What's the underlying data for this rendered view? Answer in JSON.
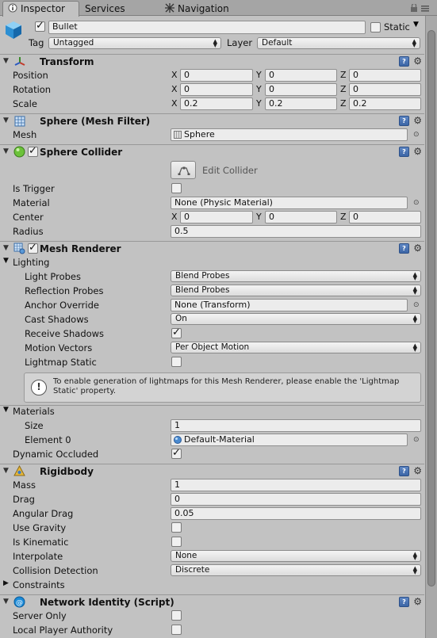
{
  "tabs": {
    "inspector": "Inspector",
    "services": "Services",
    "navigation": "Navigation"
  },
  "object": {
    "name": "Bullet",
    "static_label": "Static",
    "tag_label": "Tag",
    "tag_value": "Untagged",
    "layer_label": "Layer",
    "layer_value": "Default"
  },
  "transform": {
    "title": "Transform",
    "position_label": "Position",
    "rotation_label": "Rotation",
    "scale_label": "Scale",
    "x": "X",
    "y": "Y",
    "z": "Z",
    "position": [
      "0",
      "0",
      "0"
    ],
    "rotation": [
      "0",
      "0",
      "0"
    ],
    "scale": [
      "0.2",
      "0.2",
      "0.2"
    ]
  },
  "mesh_filter": {
    "title": "Sphere (Mesh Filter)",
    "mesh_label": "Mesh",
    "mesh_value": "Sphere"
  },
  "sphere_collider": {
    "title": "Sphere Collider",
    "edit_collider": "Edit Collider",
    "is_trigger_label": "Is Trigger",
    "material_label": "Material",
    "material_value": "None (Physic Material)",
    "center_label": "Center",
    "center": [
      "0",
      "0",
      "0"
    ],
    "radius_label": "Radius",
    "radius_value": "0.5"
  },
  "mesh_renderer": {
    "title": "Mesh Renderer",
    "lighting_label": "Lighting",
    "light_probes_label": "Light Probes",
    "light_probes_value": "Blend Probes",
    "reflection_probes_label": "Reflection Probes",
    "reflection_probes_value": "Blend Probes",
    "anchor_override_label": "Anchor Override",
    "anchor_override_value": "None (Transform)",
    "cast_shadows_label": "Cast Shadows",
    "cast_shadows_value": "On",
    "receive_shadows_label": "Receive Shadows",
    "motion_vectors_label": "Motion Vectors",
    "motion_vectors_value": "Per Object Motion",
    "lightmap_static_label": "Lightmap Static",
    "help_text": "To enable generation of lightmaps for this Mesh Renderer, please enable the 'Lightmap Static' property.",
    "materials_label": "Materials",
    "size_label": "Size",
    "size_value": "1",
    "element0_label": "Element 0",
    "element0_value": "Default-Material",
    "dynamic_occluded_label": "Dynamic Occluded"
  },
  "rigidbody": {
    "title": "Rigidbody",
    "mass_label": "Mass",
    "mass_value": "1",
    "drag_label": "Drag",
    "drag_value": "0",
    "angular_drag_label": "Angular Drag",
    "angular_drag_value": "0.05",
    "use_gravity_label": "Use Gravity",
    "is_kinematic_label": "Is Kinematic",
    "interpolate_label": "Interpolate",
    "interpolate_value": "None",
    "collision_detection_label": "Collision Detection",
    "collision_detection_value": "Discrete",
    "constraints_label": "Constraints"
  },
  "network_identity": {
    "title": "Network Identity (Script)",
    "server_only_label": "Server Only",
    "local_player_authority_label": "Local Player Authority"
  },
  "icons": {
    "help": "help-book-icon",
    "gear": "gear-icon",
    "fold": "triangle-down-icon"
  }
}
